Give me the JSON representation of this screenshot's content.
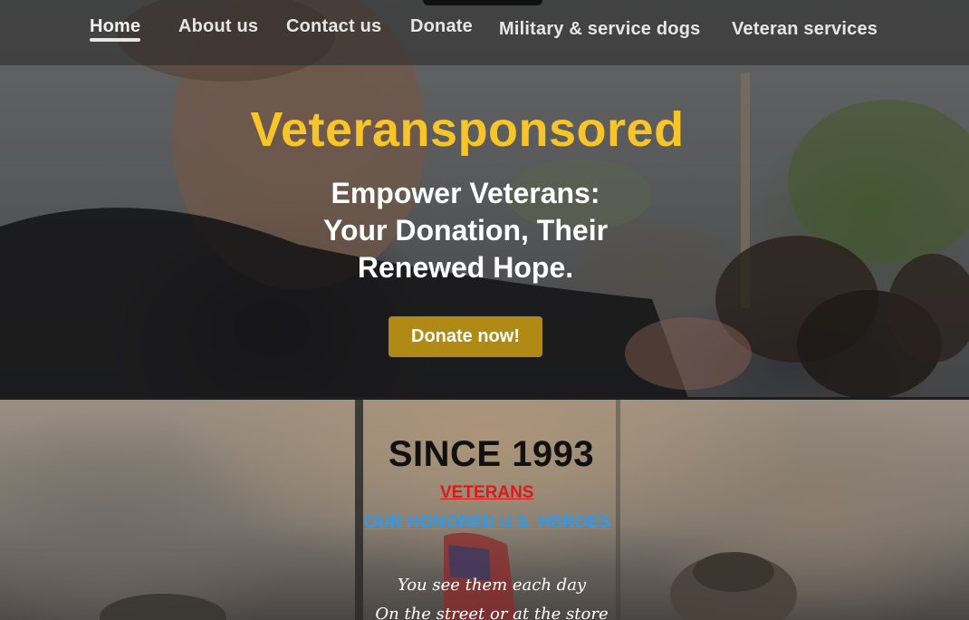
{
  "nav": {
    "items": [
      {
        "label": "Home",
        "active": true
      },
      {
        "label": "About us"
      },
      {
        "label": "Contact us"
      },
      {
        "label": "Donate"
      },
      {
        "label": "Military & service dogs"
      },
      {
        "label": "Veteran services"
      }
    ]
  },
  "hero": {
    "brand": "Veteransponsored",
    "tagline_lines": [
      "Empower Veterans:",
      "Your Donation, Their",
      "Renewed Hope."
    ],
    "cta_label": "Donate now!"
  },
  "section2": {
    "title": "SINCE 1993",
    "veterans_link": "VETERANS",
    "heroes_link": "OUR HONORED U.S. HEROES",
    "poem_lines": [
      "You see them each day",
      "On the street or at the store"
    ]
  },
  "colors": {
    "brand": "#f7c52a",
    "cta": "#b08a14",
    "veterans_link": "#e01818",
    "heroes_link": "#2b9bf0"
  }
}
